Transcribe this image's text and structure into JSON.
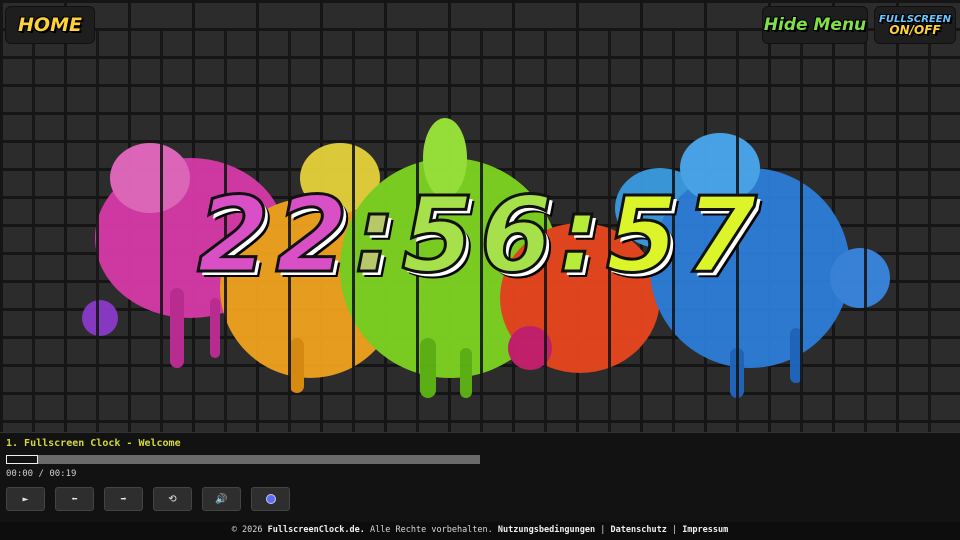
{
  "header": {
    "home_label": "HOME",
    "hide_menu_label": "Hide Menu",
    "fullscreen_label": "FULLSCREEN",
    "fullscreen_toggle_label": "ON/OFF"
  },
  "clock": {
    "hh": "22",
    "sep1": ":",
    "mm": "56",
    "sep2": ":",
    "ss": "57",
    "colors": [
      "#e04fc8",
      "#d69a6a",
      "#a8d84a",
      "#8fe43e",
      "#c8f03a",
      "#e6f62a"
    ]
  },
  "player": {
    "track_title": "1. Fullscreen Clock - Welcome",
    "time_display": "00:00 / 00:19",
    "progress_fraction": 0.0,
    "buttons": {
      "play": "►",
      "prev": "⬅",
      "next": "➡",
      "repeat": "⟲",
      "volume": "🔊"
    }
  },
  "footer": {
    "prefix": "© 2026",
    "site": "FullscreenClock.de.",
    "rights": "Alle Rechte vorbehalten.",
    "terms": "Nutzungsbedingungen",
    "sep": "|",
    "privacy": "Datenschutz",
    "imprint": "Impressum"
  }
}
